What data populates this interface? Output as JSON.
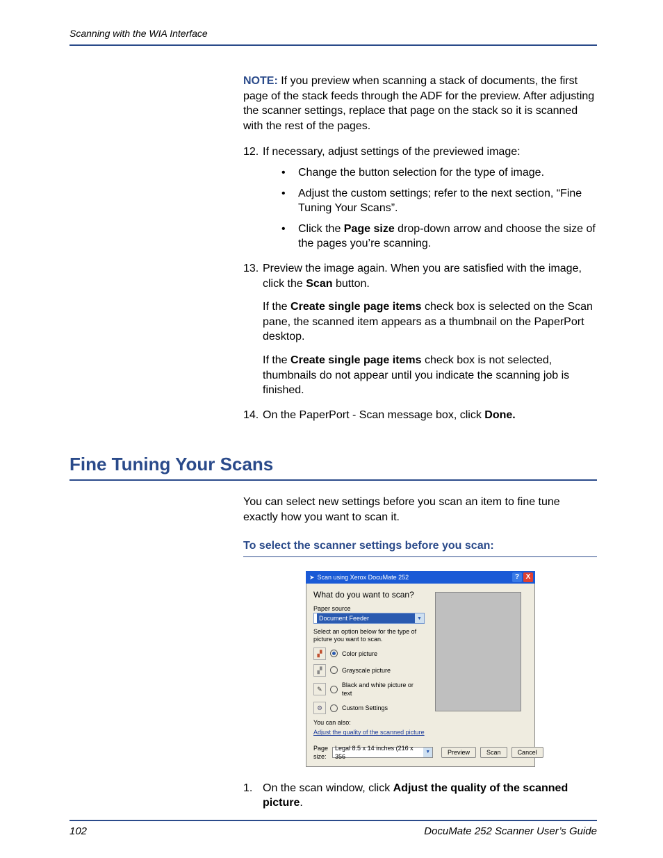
{
  "header": {
    "running": "Scanning with the WIA Interface"
  },
  "note": {
    "label": "NOTE:",
    "text": "If you preview when scanning a stack of documents, the first page of the stack feeds through the ADF for the preview. After adjusting the scanner settings, replace that page on the stack so it is scanned with the rest of the pages."
  },
  "step12": {
    "num": "12.",
    "lead": "If necessary, adjust settings of the previewed image:",
    "bullets": {
      "a": "Change the button selection for the type of image.",
      "b1": "Adjust the custom settings; refer to the next section, “Fine Tuning Your Scans”.",
      "c_pre": "Click the ",
      "c_bold": "Page size",
      "c_post": " drop-down arrow and choose the size of the pages you’re scanning."
    }
  },
  "step13": {
    "num": "13.",
    "lead_pre": "Preview the image again. When you are satisfied with the image, click the ",
    "lead_bold": "Scan",
    "lead_post": " button.",
    "p2_pre": "If the ",
    "p2_bold": "Create single page items",
    "p2_post": " check box is selected on the Scan pane, the scanned item appears as a thumbnail on the PaperPort desktop.",
    "p3_pre": "If the ",
    "p3_bold": "Create single page items",
    "p3_post": " check box is not selected, thumbnails do not appear until you indicate the scanning job is finished."
  },
  "step14": {
    "num": "14.",
    "pre": "On the PaperPort - Scan message box, click ",
    "bold": "Done."
  },
  "section": {
    "title": "Fine Tuning Your Scans"
  },
  "intro": "You can select new settings before you scan an item to fine tune exactly how you want to scan it.",
  "subhead": "To select the scanner settings before you scan:",
  "dialog": {
    "title": "Scan using Xerox DocuMate 252",
    "question": "What do you want to scan?",
    "paper_label": "Paper source",
    "paper_value": "Document Feeder",
    "select_text": "Select an option below for the type of picture you want to scan.",
    "opt_color": "Color picture",
    "opt_gray": "Grayscale picture",
    "opt_bw": "Black and white picture or text",
    "opt_custom": "Custom Settings",
    "also": "You can also:",
    "adjust": "Adjust the quality of the scanned picture",
    "pagesize_label": "Page size:",
    "pagesize_value": "Legal 8.5 x 14 inches (216 x 356",
    "btn_preview": "Preview",
    "btn_scan": "Scan",
    "btn_cancel": "Cancel",
    "help": "?",
    "close": "X"
  },
  "step1": {
    "num": "1.",
    "pre": "On the scan window, click ",
    "bold": "Adjust the quality of the scanned picture",
    "post": "."
  },
  "footer": {
    "page": "102",
    "guide": "DocuMate 252 Scanner User’s Guide"
  }
}
